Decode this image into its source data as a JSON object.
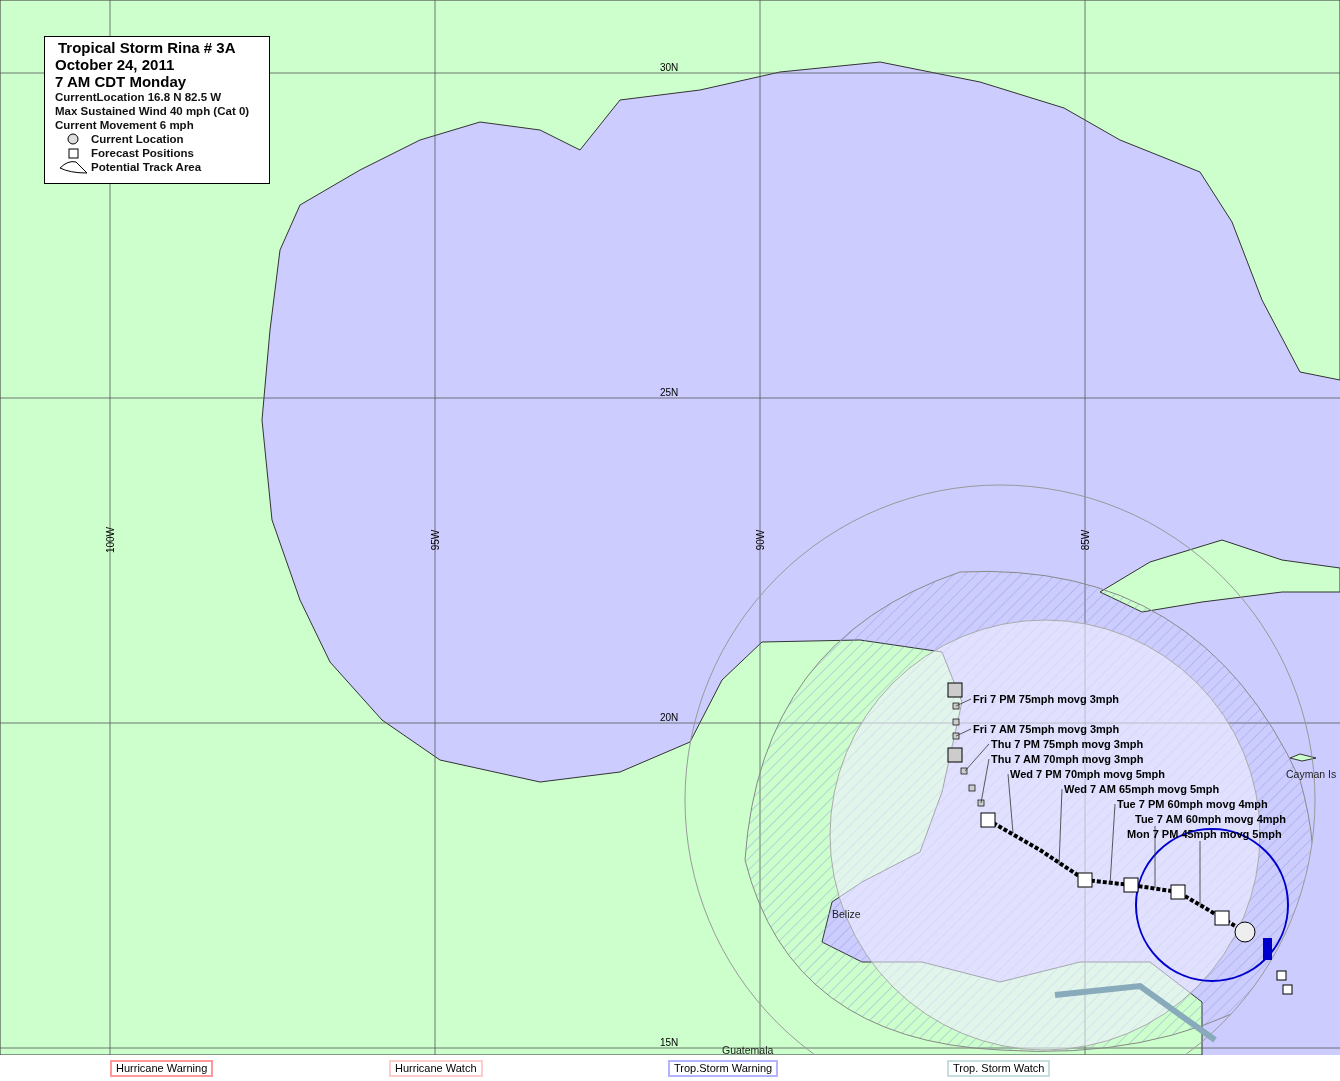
{
  "legend": {
    "title": "Tropical Storm Rina # 3A",
    "date": "October 24, 2011",
    "time": "7 AM CDT Monday",
    "lines": [
      "CurrentLocation 16.8 N  82.5 W",
      "Max Sustained Wind 40 mph (Cat 0)",
      "Current Movement 6 mph"
    ],
    "keys": [
      {
        "kind": "circle",
        "label": "Current Location"
      },
      {
        "kind": "square",
        "label": "Forecast Positions"
      },
      {
        "kind": "area",
        "label": "Potential Track Area"
      }
    ]
  },
  "grid_labels": {
    "latitudes": [
      "30N",
      "25N",
      "20N",
      "15N"
    ],
    "longitudes": [
      "100W",
      "95W",
      "90W",
      "85W"
    ]
  },
  "places": [
    "Belize",
    "Guatemala",
    "Cayman Is"
  ],
  "forecasts": [
    "Fri 7 PM 75mph movg 3mph",
    "Fri 7 AM 75mph movg 3mph",
    "Thu 7 PM 75mph movg 3mph",
    "Thu 7 AM 70mph movg 3mph",
    "Wed 7 PM 70mph movg 5mph",
    "Wed 7 AM 65mph movg 5mph",
    "Tue 7 PM 60mph movg 4mph",
    "Tue 7 AM 60mph movg 4mph",
    "Mon 7 PM 45mph movg 5mph"
  ],
  "warnings": [
    {
      "label": "Hurricane Warning",
      "color": "#ff9999"
    },
    {
      "label": "Hurricane  Watch",
      "color": "#ffcccc"
    },
    {
      "label": "Trop.Storm Warning",
      "color": "#b3b3ff"
    },
    {
      "label": "Trop. Storm Watch",
      "color": "#c6dede"
    }
  ]
}
